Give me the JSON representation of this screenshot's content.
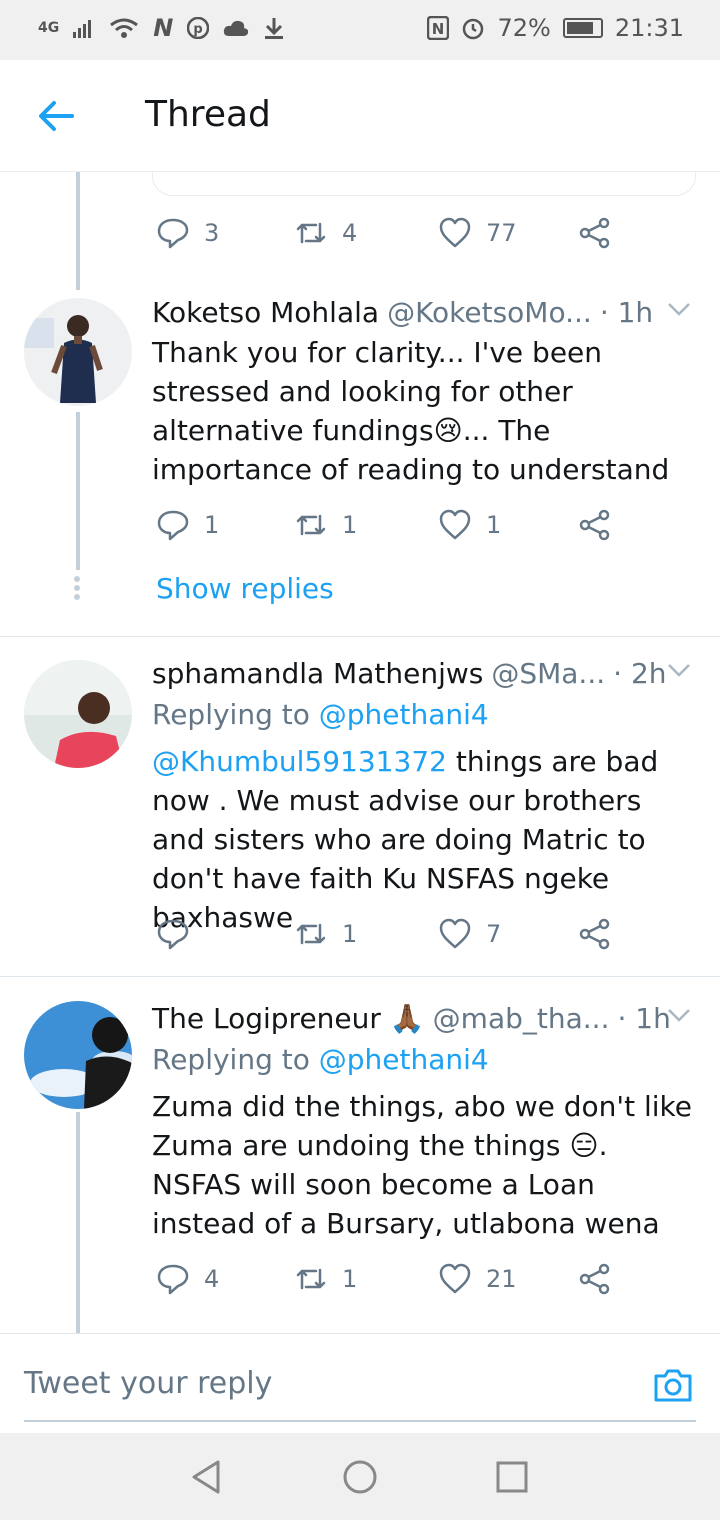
{
  "status_bar": {
    "network": "4G",
    "battery": "72%",
    "time": "21:31"
  },
  "app_bar": {
    "title": "Thread"
  },
  "tweets": [
    {
      "counts": {
        "replies": "3",
        "retweets": "4",
        "likes": "77"
      }
    },
    {
      "name": "Koketso Mohlala",
      "handle": "@KoketsoMo...",
      "time": "· 1h",
      "text": "Thank you for clarity... I've been stressed and looking for other alternative fundings😢... The importance of reading to understand",
      "counts": {
        "replies": "1",
        "retweets": "1",
        "likes": "1"
      },
      "show_replies": "Show replies"
    },
    {
      "name": "sphamandla Mathenjws",
      "handle": "@SMa...",
      "time": "· 2h",
      "replying_prefix": "Replying to",
      "replying_to": "@phethani4",
      "mention": "@Khumbul59131372",
      "text": " things are bad now . We must advise our brothers and sisters who are doing Matric to don't have faith Ku NSFAS ngeke baxhaswe",
      "counts": {
        "replies": "",
        "retweets": "1",
        "likes": "7"
      }
    },
    {
      "name": "The Logipreneur 🙏🏾",
      "handle": "@mab_tha...",
      "time": "· 1h",
      "replying_prefix": "Replying to",
      "replying_to": "@phethani4",
      "text": "Zuma did the things, abo we don't like Zuma are undoing the things 😑. NSFAS will soon become a Loan instead of a Bursary, utlabona wena",
      "counts": {
        "replies": "4",
        "retweets": "1",
        "likes": "21"
      }
    }
  ],
  "reply_bar": {
    "placeholder": "Tweet your reply"
  },
  "colors": {
    "accent": "#1da1f2",
    "secondary_text": "#657786",
    "thread_line": "#c4d0d9"
  }
}
